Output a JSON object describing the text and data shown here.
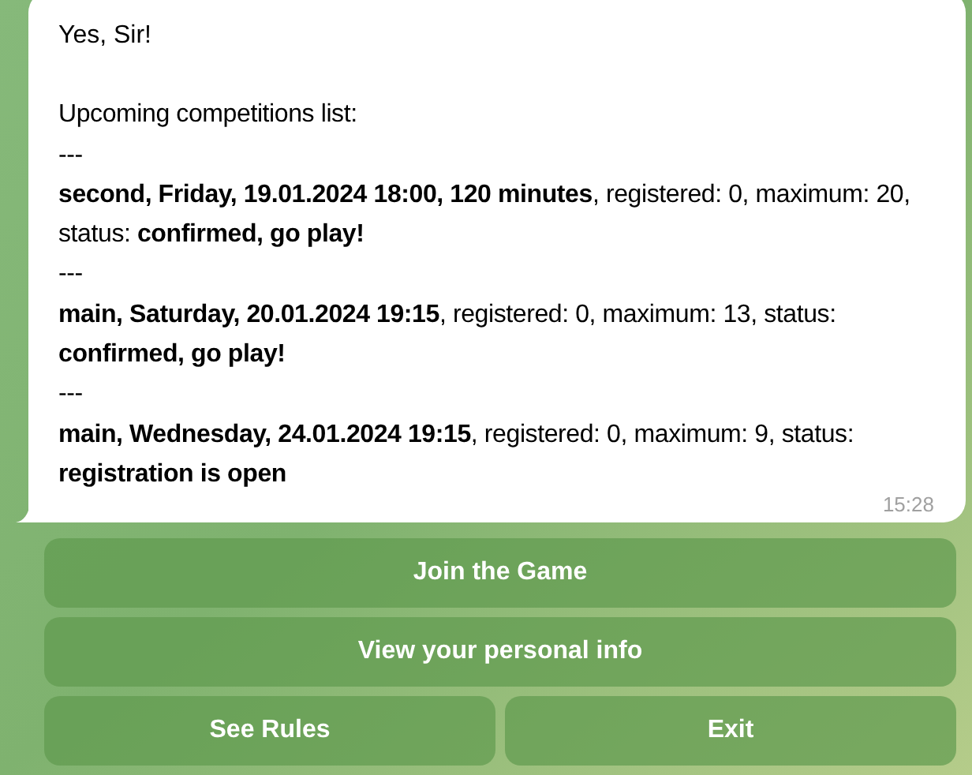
{
  "message": {
    "greeting": "Yes, Sir!",
    "lines": [
      "Upcoming competitions list:",
      "---",
      "**second, Friday, 19.01.2024 18:00, 120 minutes**, registered: 0, maximum: 20, status: **confirmed, go play!**",
      "---",
      "**main, Saturday, 20.01.2024 19:15**, registered: 0, maximum: 13, status: **confirmed, go play!**",
      "---",
      "**main, Wednesday, 24.01.2024 19:15**, registered: 0, maximum: 9, status: **registration is open**"
    ],
    "time": "15:28"
  },
  "keyboard": [
    [
      "Join the Game"
    ],
    [
      "View your personal info"
    ],
    [
      "See Rules",
      "Exit"
    ]
  ]
}
